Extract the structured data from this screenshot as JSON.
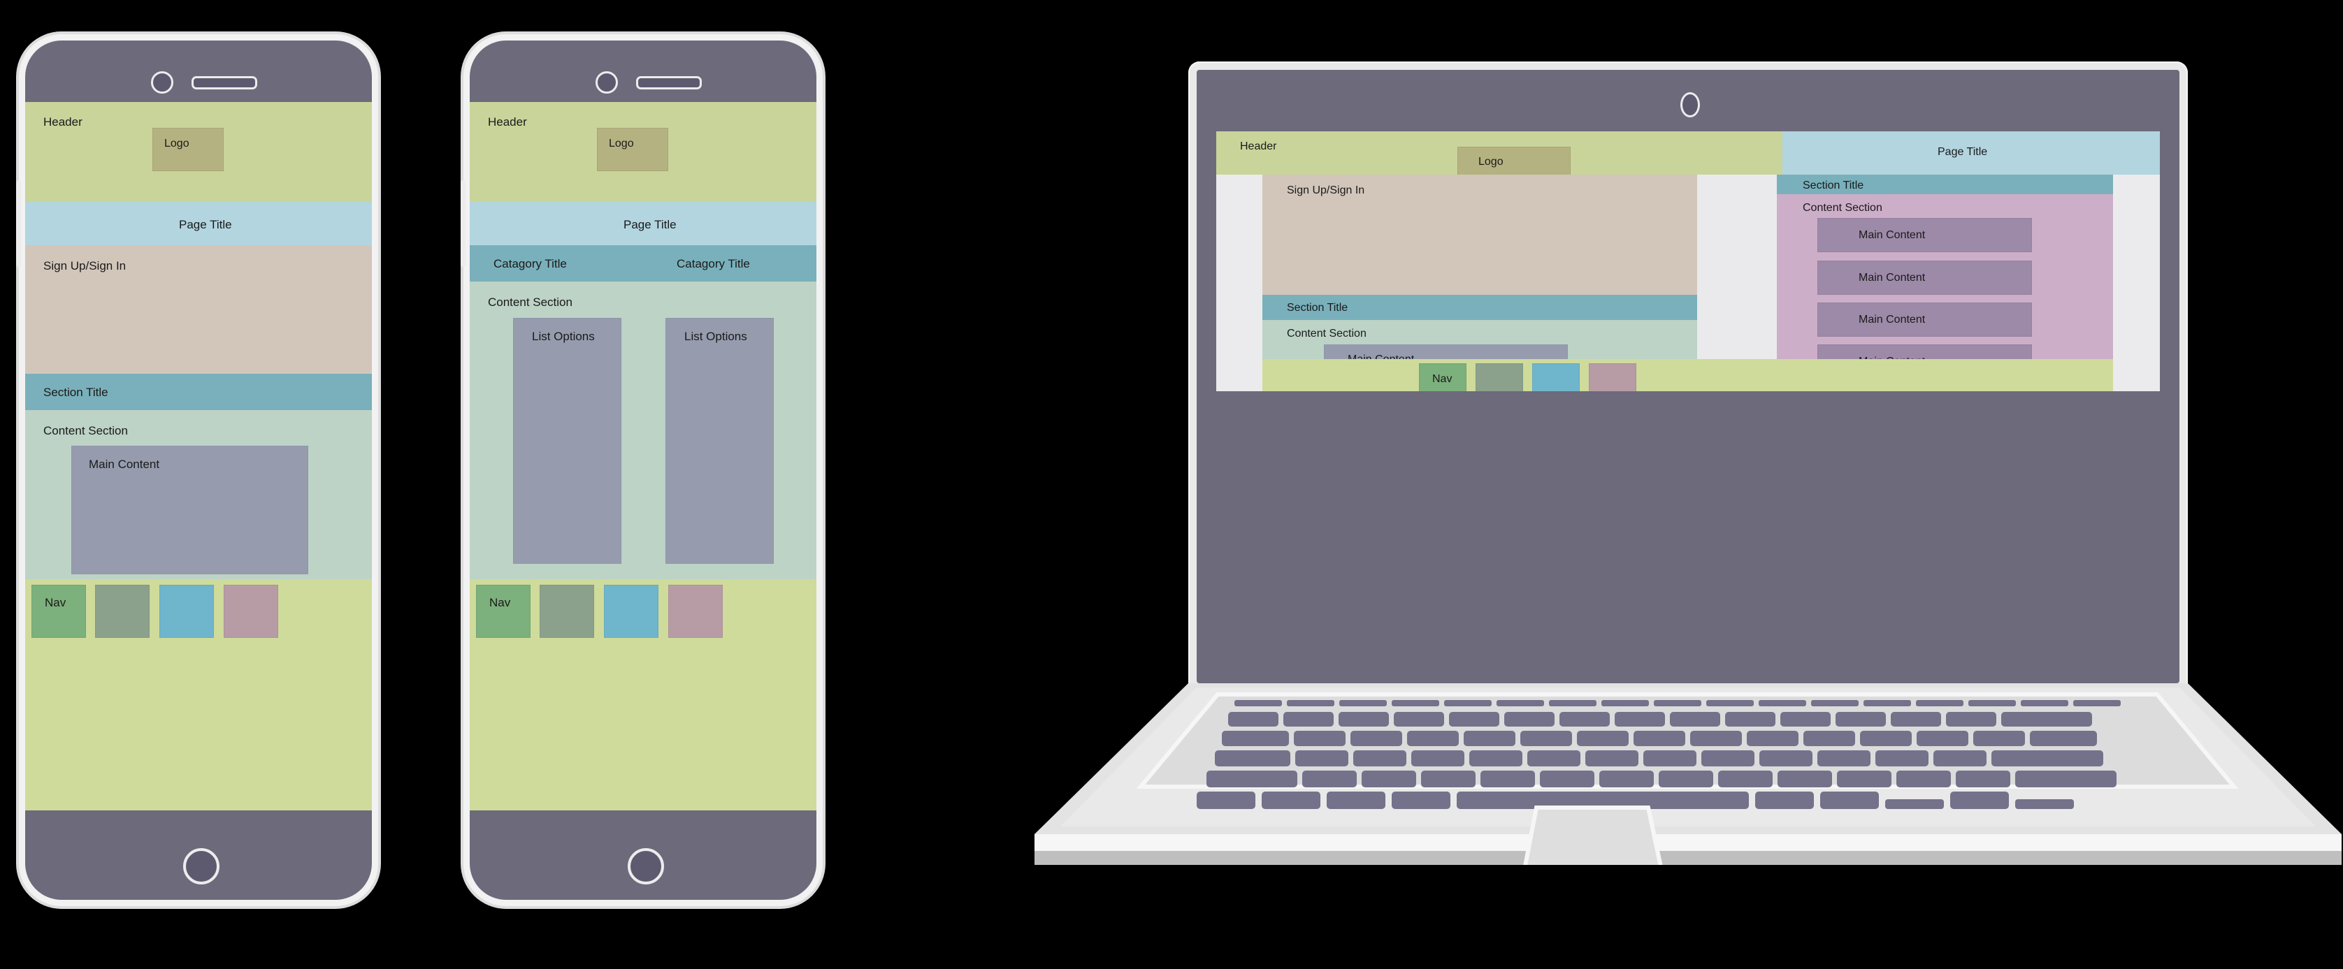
{
  "labels": {
    "header": "Header",
    "logo": "Logo",
    "page_title": "Page Title",
    "sign_up_sign_in": "Sign Up/Sign In",
    "section_title": "Section Title",
    "content_section": "Content Section",
    "main_content": "Main Content",
    "catagory_title": "Catagory Title",
    "list_options": "List Options",
    "nav": "Nav"
  },
  "colors": {
    "device_frame": "#6d6a7c",
    "frame_outline": "#f2f2f2",
    "header_green": "#c9d49a",
    "page_title_blue": "#b2d5e0",
    "signup_tan": "#d2c6ba",
    "section_title_teal": "#79b0bb",
    "content_mint": "#bcd3c6",
    "logo_olive": "#b5b281",
    "main_content_gray": "#969cae",
    "nav_green": "#cfdb9b",
    "nav_cell_1": "#7cb07c",
    "nav_cell_2": "#8ba18b",
    "nav_cell_3": "#6fb5cb",
    "nav_cell_4": "#b79ba5",
    "laptop_purple": "#cdaec9",
    "laptop_purple_box": "#9d8aa8",
    "laptop_body": "#e3e3e3",
    "key_color": "#74718a"
  },
  "devices": [
    {
      "kind": "phone",
      "name": "phone-mockup-one",
      "screen_blocks": [
        {
          "name": "header",
          "label": "Header"
        },
        {
          "name": "logo",
          "label": "Logo"
        },
        {
          "name": "page-title",
          "label": "Page Title"
        },
        {
          "name": "sign-up-sign-in",
          "label": "Sign Up/Sign In"
        },
        {
          "name": "section-title",
          "label": "Section Title"
        },
        {
          "name": "content-section",
          "label": "Content Section"
        },
        {
          "name": "main-content",
          "label": "Main Content"
        },
        {
          "name": "nav",
          "label": "Nav"
        }
      ]
    },
    {
      "kind": "phone",
      "name": "phone-mockup-two",
      "screen_blocks": [
        {
          "name": "header",
          "label": "Header"
        },
        {
          "name": "logo",
          "label": "Logo"
        },
        {
          "name": "page-title",
          "label": "Page Title"
        },
        {
          "name": "catagory-title-left",
          "label": "Catagory Title"
        },
        {
          "name": "catagory-title-right",
          "label": "Catagory Title"
        },
        {
          "name": "content-section",
          "label": "Content Section"
        },
        {
          "name": "list-options-left",
          "label": "List Options"
        },
        {
          "name": "list-options-right",
          "label": "List Options"
        },
        {
          "name": "nav",
          "label": "Nav"
        }
      ]
    },
    {
      "kind": "laptop",
      "name": "laptop-mockup",
      "screen_blocks": [
        {
          "name": "header",
          "label": "Header"
        },
        {
          "name": "logo",
          "label": "Logo"
        },
        {
          "name": "page-title",
          "label": "Page Title"
        },
        {
          "name": "sign-up-sign-in",
          "label": "Sign Up/Sign In"
        },
        {
          "name": "section-title-main",
          "label": "Section Title"
        },
        {
          "name": "content-section-main",
          "label": "Content Section"
        },
        {
          "name": "main-content-main",
          "label": "Main Content"
        },
        {
          "name": "section-title-aside",
          "label": "Section Title"
        },
        {
          "name": "content-section-aside",
          "label": "Content Section"
        },
        {
          "name": "aside-main-content-1",
          "label": "Main Content"
        },
        {
          "name": "aside-main-content-2",
          "label": "Main Content"
        },
        {
          "name": "aside-main-content-3",
          "label": "Main Content"
        },
        {
          "name": "aside-main-content-4",
          "label": "Main Content"
        },
        {
          "name": "nav",
          "label": "Nav"
        }
      ]
    }
  ]
}
